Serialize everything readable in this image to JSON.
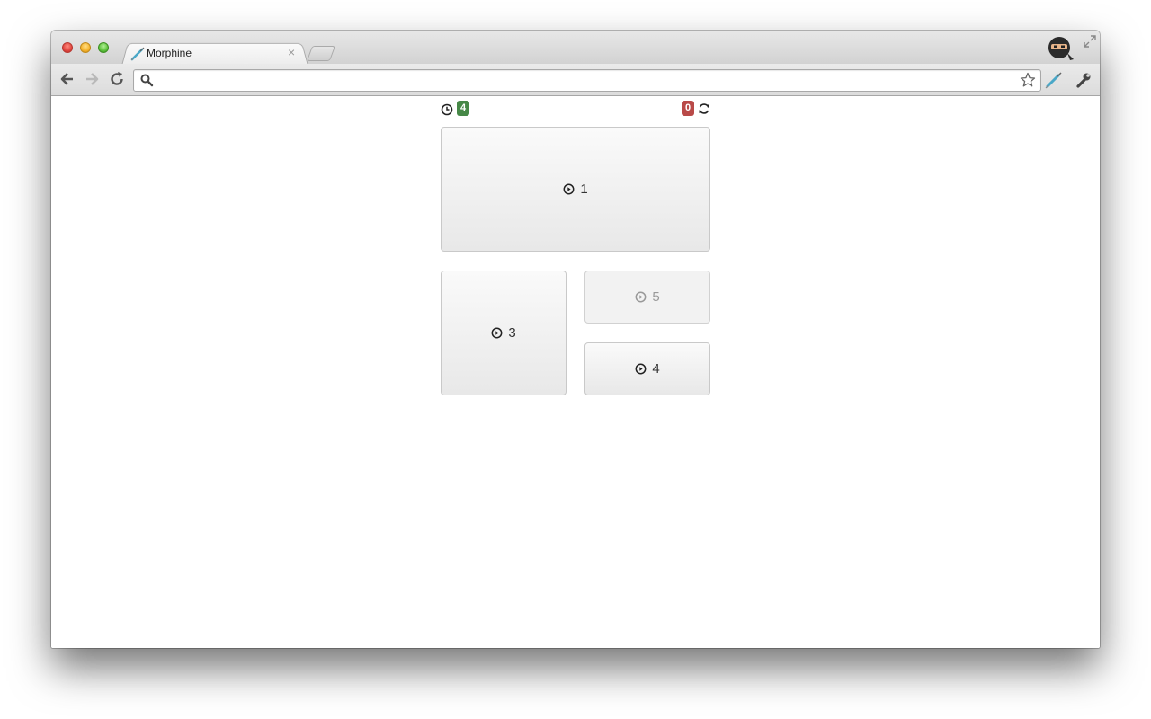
{
  "browser": {
    "tab_title": "Morphine",
    "tab_close": "×",
    "address_value": "",
    "address_placeholder": ""
  },
  "icons": {
    "back": "back-arrow-icon",
    "forward": "forward-arrow-icon",
    "reload": "reload-icon",
    "search": "search-icon",
    "star": "star-icon",
    "extension": "syringe-icon",
    "menu": "wrench-icon"
  },
  "header": {
    "pending_count": "4",
    "error_count": "0"
  },
  "colors": {
    "pending_badge": "#468847",
    "error_badge": "#b94a48"
  },
  "tiles": [
    {
      "label": "1",
      "state": "active"
    },
    {
      "label": "3",
      "state": "active"
    },
    {
      "label": "5",
      "state": "disabled"
    },
    {
      "label": "4",
      "state": "active"
    }
  ]
}
